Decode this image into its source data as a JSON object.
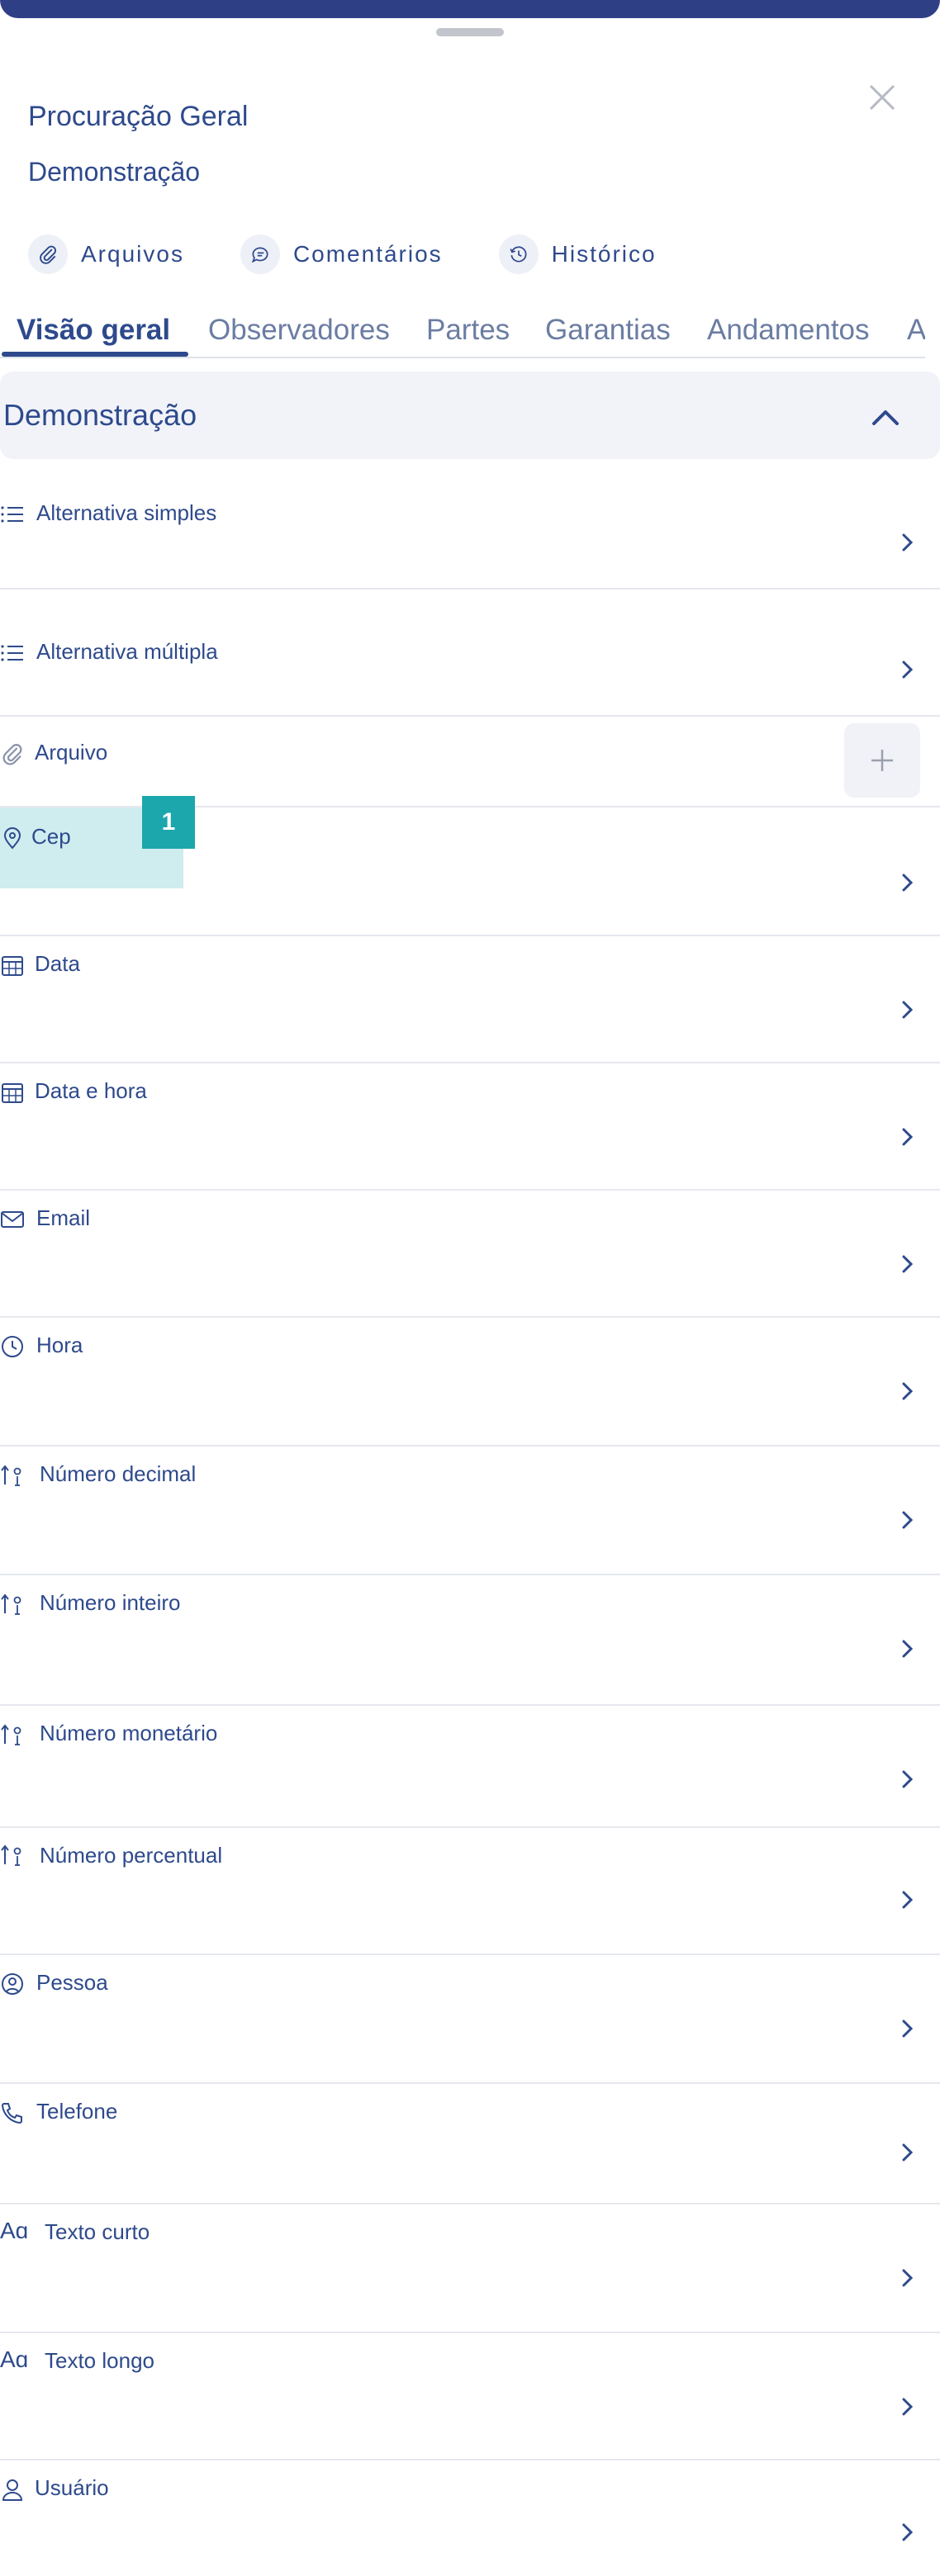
{
  "header": {
    "title": "Procuração Geral",
    "subtitle": "Demonstração"
  },
  "actions": [
    {
      "label": "Arquivos",
      "icon": "paperclip-icon"
    },
    {
      "label": "Comentários",
      "icon": "comment-icon"
    },
    {
      "label": "Histórico",
      "icon": "history-icon"
    }
  ],
  "tabs": [
    {
      "label": "Visão geral",
      "active": true
    },
    {
      "label": "Observadores",
      "active": false
    },
    {
      "label": "Partes",
      "active": false
    },
    {
      "label": "Garantias",
      "active": false
    },
    {
      "label": "Andamentos",
      "active": false
    },
    {
      "label": "A",
      "active": false
    }
  ],
  "section": {
    "title": "Demonstração",
    "expanded": true
  },
  "fields": [
    {
      "label": "Alternativa simples",
      "icon": "list-icon"
    },
    {
      "label": "Alternativa múltipla",
      "icon": "list-icon"
    },
    {
      "label": "Arquivo",
      "icon": "paperclip-icon"
    },
    {
      "label": "Cep",
      "icon": "map-pin-icon"
    },
    {
      "label": "Data",
      "icon": "calendar-icon"
    },
    {
      "label": "Data e hora",
      "icon": "calendar-icon"
    },
    {
      "label": "Email",
      "icon": "envelope-icon"
    },
    {
      "label": "Hora",
      "icon": "clock-icon"
    },
    {
      "label": "Número decimal",
      "icon": "sort-numeric-icon"
    },
    {
      "label": "Número inteiro",
      "icon": "sort-numeric-icon"
    },
    {
      "label": "Número monetário",
      "icon": "sort-numeric-icon"
    },
    {
      "label": "Número percentual",
      "icon": "sort-numeric-icon"
    },
    {
      "label": "Pessoa",
      "icon": "person-circle-icon"
    },
    {
      "label": "Telefone",
      "icon": "phone-icon"
    },
    {
      "label": "Texto curto",
      "icon": "text-icon"
    },
    {
      "label": "Texto longo",
      "icon": "text-icon"
    },
    {
      "label": "Usuário",
      "icon": "user-icon"
    }
  ],
  "annotation": {
    "badge": "1"
  },
  "colors": {
    "primary": "#2e4a8c",
    "topbar": "#2f3f86",
    "section_bg": "#f1f3f9",
    "highlight": "#cfecef",
    "badge": "#1ca7ad"
  }
}
